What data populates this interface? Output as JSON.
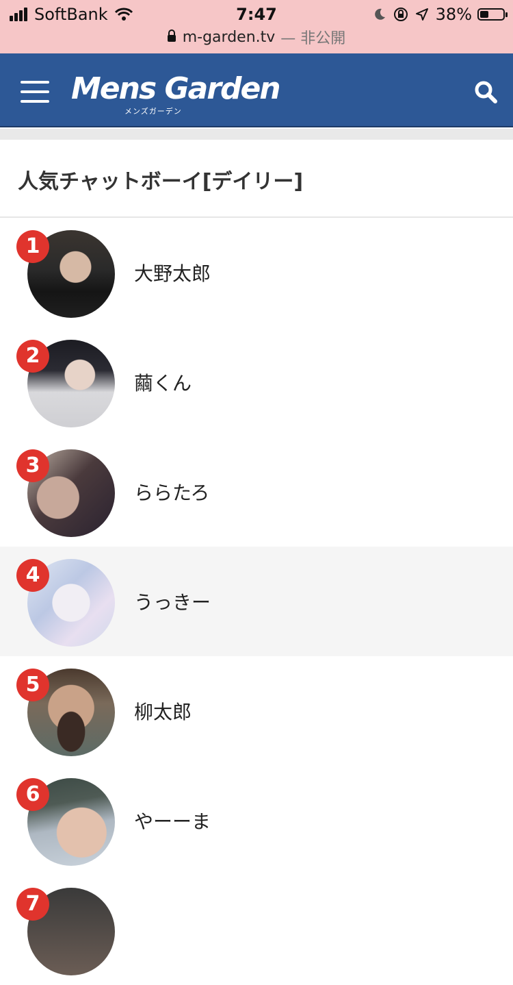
{
  "status_bar": {
    "carrier": "SoftBank",
    "time": "7:47",
    "battery": "38%",
    "battery_level": 0.38
  },
  "url_bar": {
    "domain": "m-garden.tv",
    "note": "— 非公開"
  },
  "header": {
    "logo": "Mens Garden",
    "logo_sub": "メンズガーデン"
  },
  "section": {
    "title": "人気チャットボーイ[デイリー]"
  },
  "ranking": [
    {
      "rank": "1",
      "name": "大野太郎"
    },
    {
      "rank": "2",
      "name": "繭くん"
    },
    {
      "rank": "3",
      "name": "ららたろ"
    },
    {
      "rank": "4",
      "name": "うっきー"
    },
    {
      "rank": "5",
      "name": "柳太郎"
    },
    {
      "rank": "6",
      "name": "やーーま"
    },
    {
      "rank": "7",
      "name": ""
    }
  ],
  "colors": {
    "header": "#2d5896",
    "badge": "#e0342d",
    "status_bg": "#f6c6c7"
  }
}
